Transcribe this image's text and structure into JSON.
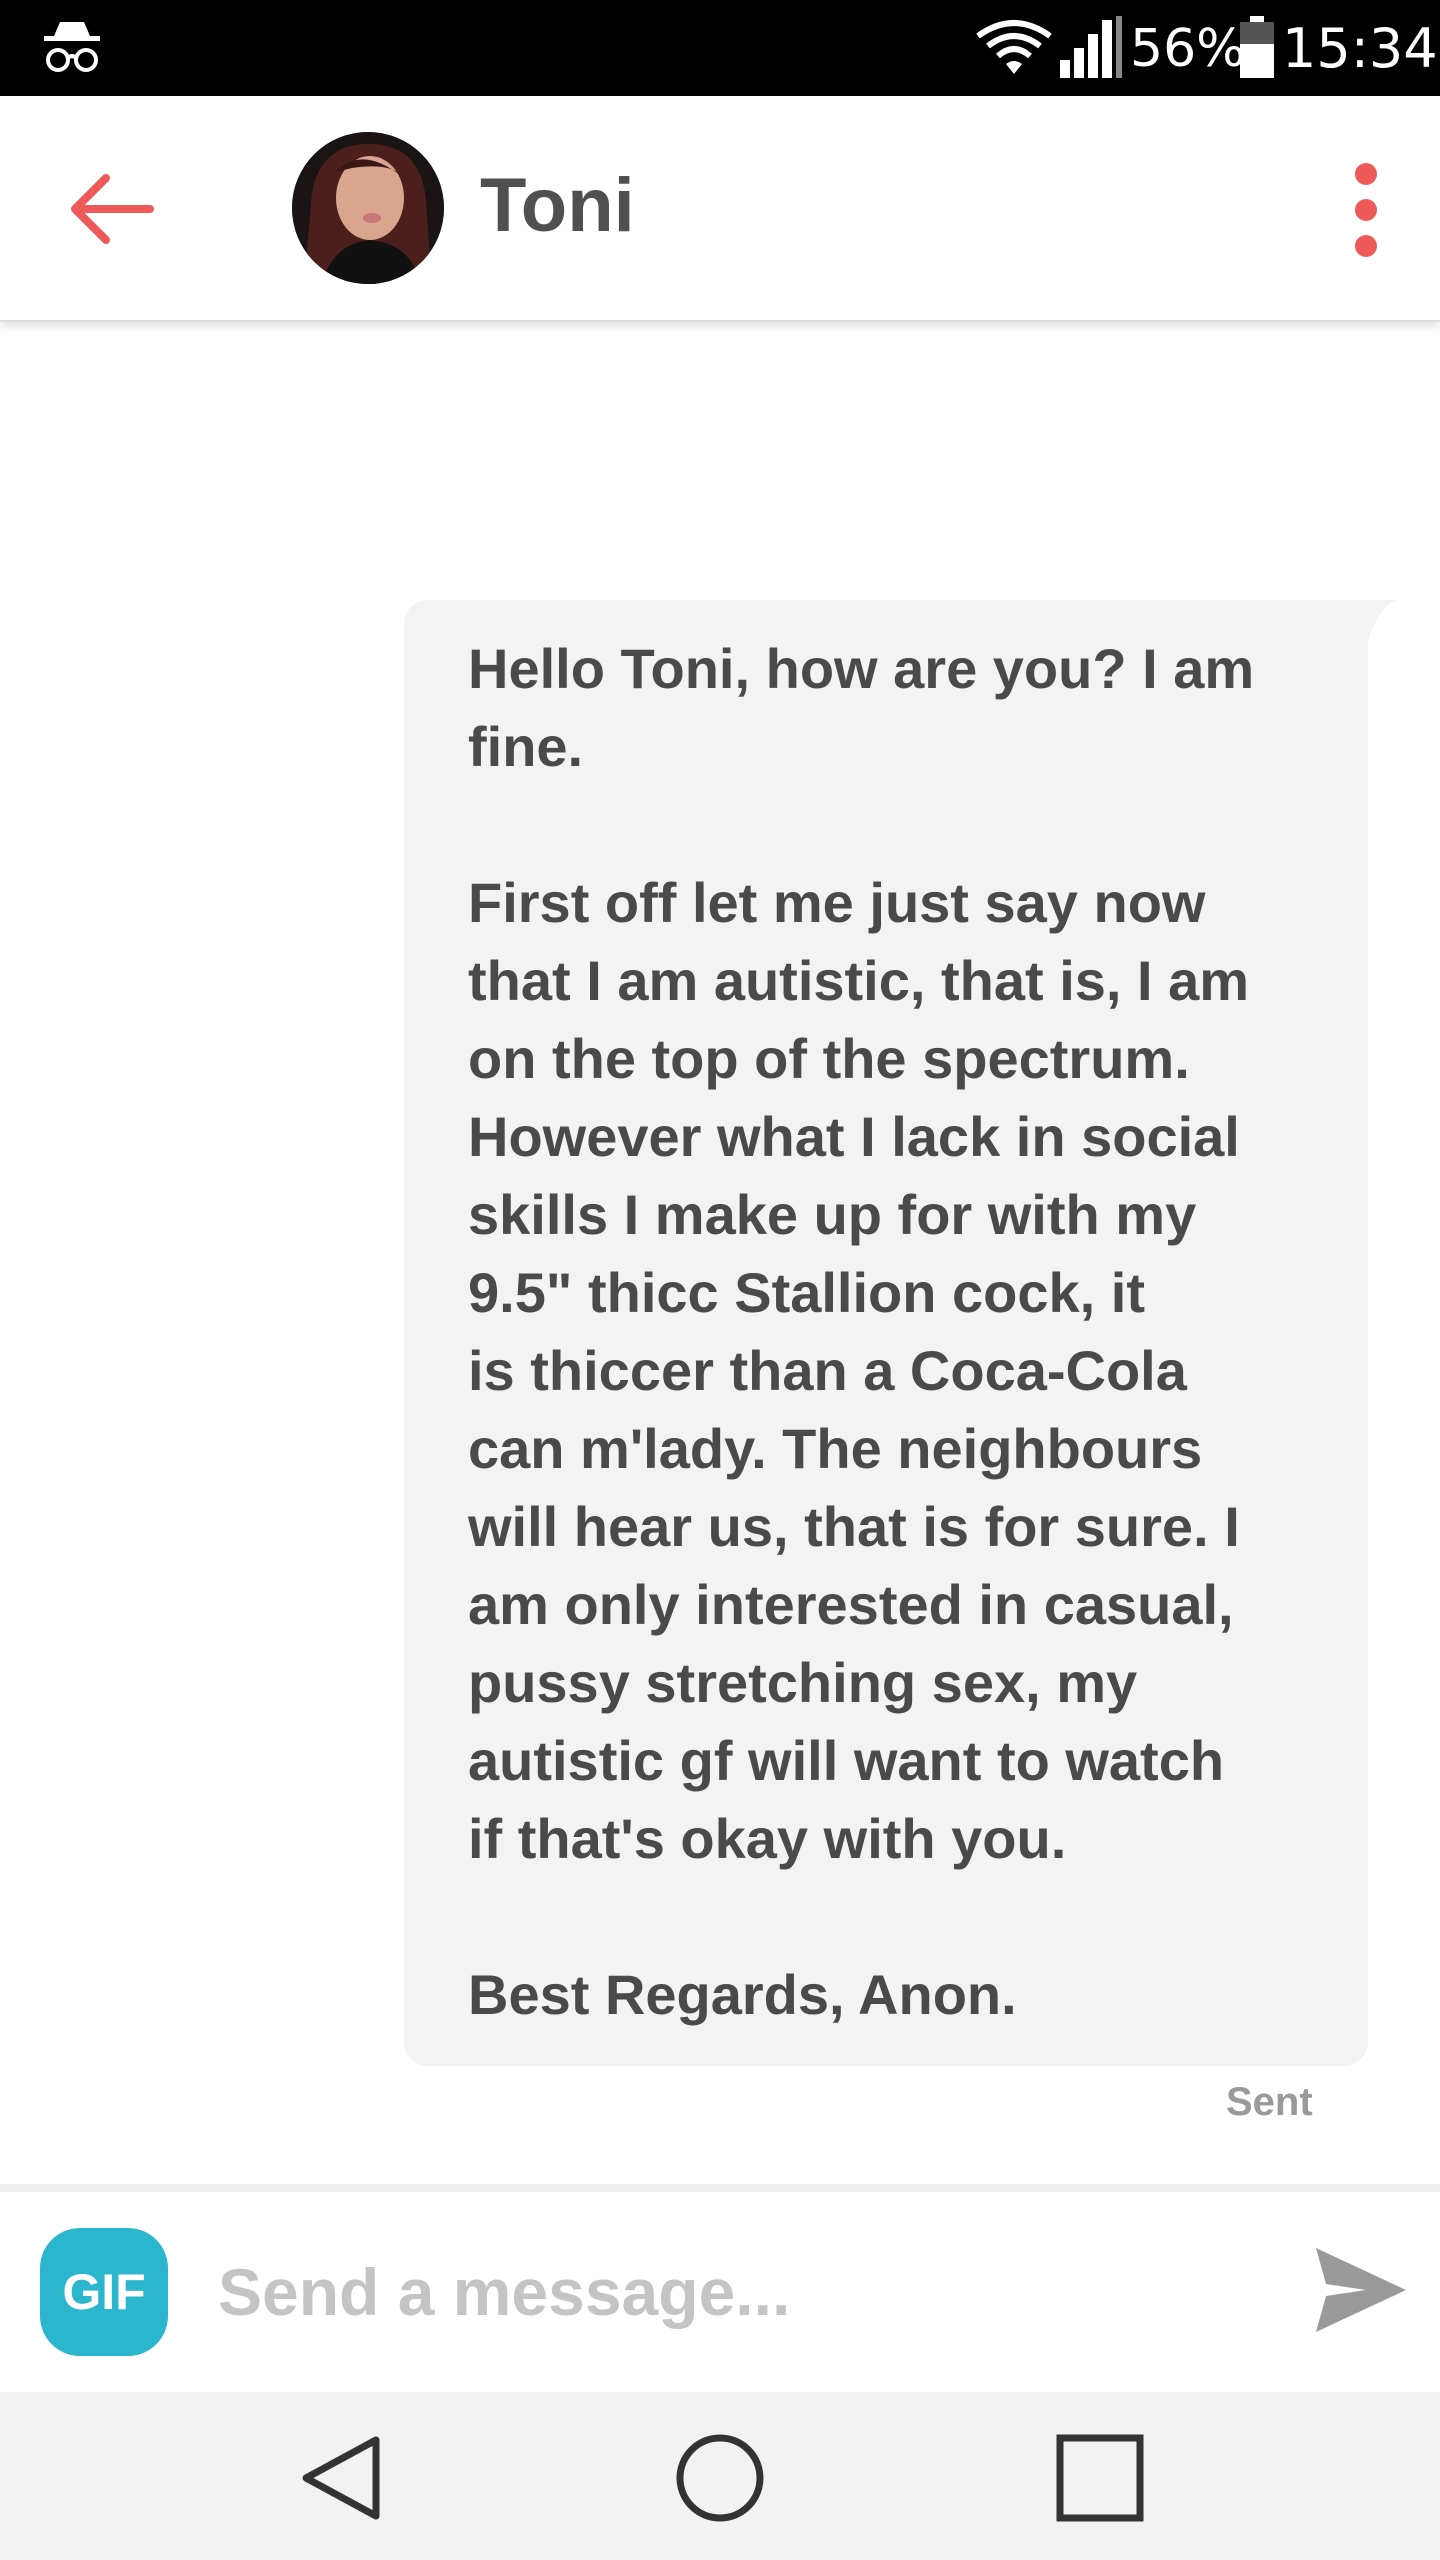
{
  "status_bar": {
    "battery_percent": "56%",
    "time": "15:34",
    "icons": [
      "incognito-icon",
      "wifi-icon",
      "signal-icon",
      "battery-icon"
    ]
  },
  "header": {
    "contact_name": "Toni",
    "back_icon": "arrow-left-icon",
    "menu_icon": "more-vertical-icon",
    "accent_color": "#ee5a5a"
  },
  "conversation": {
    "messages": [
      {
        "paragraphs": [
          "Hello Toni, how are you? I am\nfine.",
          "First off let me just say now\nthat I am autistic, that is, I am\non the top of the spectrum.\nHowever what I lack in social\nskills I make up for with my\n9.5\" thicc Stallion cock, it\nis thiccer than a Coca-Cola\ncan m'lady. The neighbours\nwill hear us, that is for sure. I\nam only interested in casual,\npussy stretching sex, my\nautistic gf will want to watch\nif that's okay with you.",
          "Best Regards, Anon."
        ],
        "status": "Sent"
      }
    ]
  },
  "composer": {
    "gif_label": "GIF",
    "gif_color": "#2bb6cd",
    "placeholder": "Send a message...",
    "value": "",
    "send_icon": "send-icon"
  },
  "nav_bar": {
    "icons": [
      "nav-back-icon",
      "nav-home-icon",
      "nav-recents-icon"
    ]
  }
}
